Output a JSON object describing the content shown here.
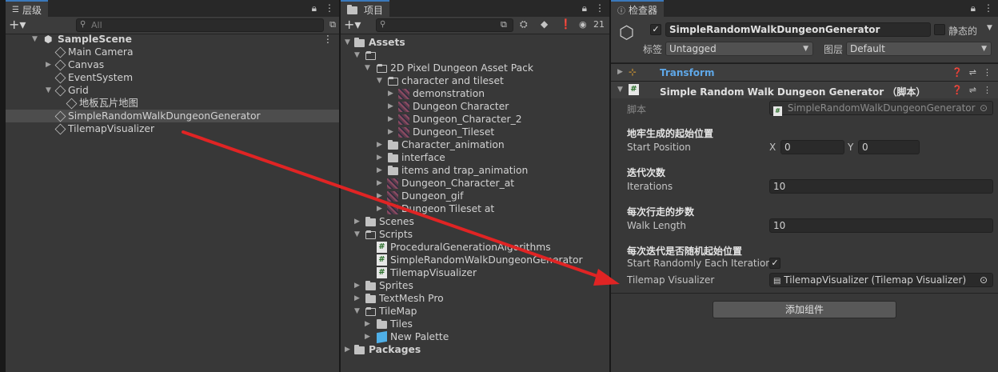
{
  "hierarchy": {
    "tab_label": "层级",
    "search_placeholder": "All",
    "scene_name": "SampleScene",
    "items": [
      {
        "label": "Main Camera"
      },
      {
        "label": "Canvas"
      },
      {
        "label": "EventSystem"
      },
      {
        "label": "Grid"
      },
      {
        "label": "地板瓦片地图"
      },
      {
        "label": "SimpleRandomWalkDungeonGenerator"
      },
      {
        "label": "TilemapVisualizer"
      }
    ]
  },
  "project": {
    "tab_label": "项目",
    "visibility_count": "21",
    "tree": [
      {
        "label": "Assets"
      },
      {
        "label": ""
      },
      {
        "label": "2D Pixel Dungeon Asset Pack"
      },
      {
        "label": "character and tileset"
      },
      {
        "label": "demonstration"
      },
      {
        "label": "Dungeon Character"
      },
      {
        "label": "Dungeon_Character_2"
      },
      {
        "label": "Dungeon_Tileset"
      },
      {
        "label": "Character_animation"
      },
      {
        "label": "interface"
      },
      {
        "label": "items and trap_animation"
      },
      {
        "label": "Dungeon_Character_at"
      },
      {
        "label": "Dungeon_gif"
      },
      {
        "label": "Dungeon Tileset at"
      },
      {
        "label": "Scenes"
      },
      {
        "label": "Scripts"
      },
      {
        "label": "ProceduralGenerationAlgorithms"
      },
      {
        "label": "SimpleRandomWalkDungeonGenerator"
      },
      {
        "label": "TilemapVisualizer"
      },
      {
        "label": "Sprites"
      },
      {
        "label": "TextMesh Pro"
      },
      {
        "label": "TileMap"
      },
      {
        "label": "Tiles"
      },
      {
        "label": "New Palette"
      },
      {
        "label": "Packages"
      }
    ]
  },
  "inspector": {
    "tab_label": "检查器",
    "object_name": "SimpleRandomWalkDungeonGenerator",
    "static_label": "静态的",
    "tag_label": "标签",
    "tag_value": "Untagged",
    "layer_label": "图层",
    "layer_value": "Default",
    "transform_label": "Transform",
    "component_title": "Simple Random Walk Dungeon Generator （脚本）",
    "script_label": "脚本",
    "script_value": "SimpleRandomWalkDungeonGenerator",
    "section_start": "地牢生成的起始位置",
    "start_position_label": "Start Position",
    "x_label": "X",
    "x_value": "0",
    "y_label": "Y",
    "y_value": "0",
    "section_iterations": "迭代次数",
    "iterations_label": "Iterations",
    "iterations_value": "10",
    "section_walk": "每次行走的步数",
    "walk_length_label": "Walk Length",
    "walk_length_value": "10",
    "section_random": "每次迭代是否随机起始位置",
    "start_randomly_label": "Start Randomly Each Iteration",
    "tilemap_visualizer_label": "Tilemap Visualizer",
    "tilemap_visualizer_value": "TilemapVisualizer (Tilemap Visualizer)",
    "add_component_label": "添加组件"
  },
  "colors": {
    "accent_blue": "#3a79bb",
    "arrow_red": "#e02424",
    "transform_blue": "#5fa8e8"
  }
}
